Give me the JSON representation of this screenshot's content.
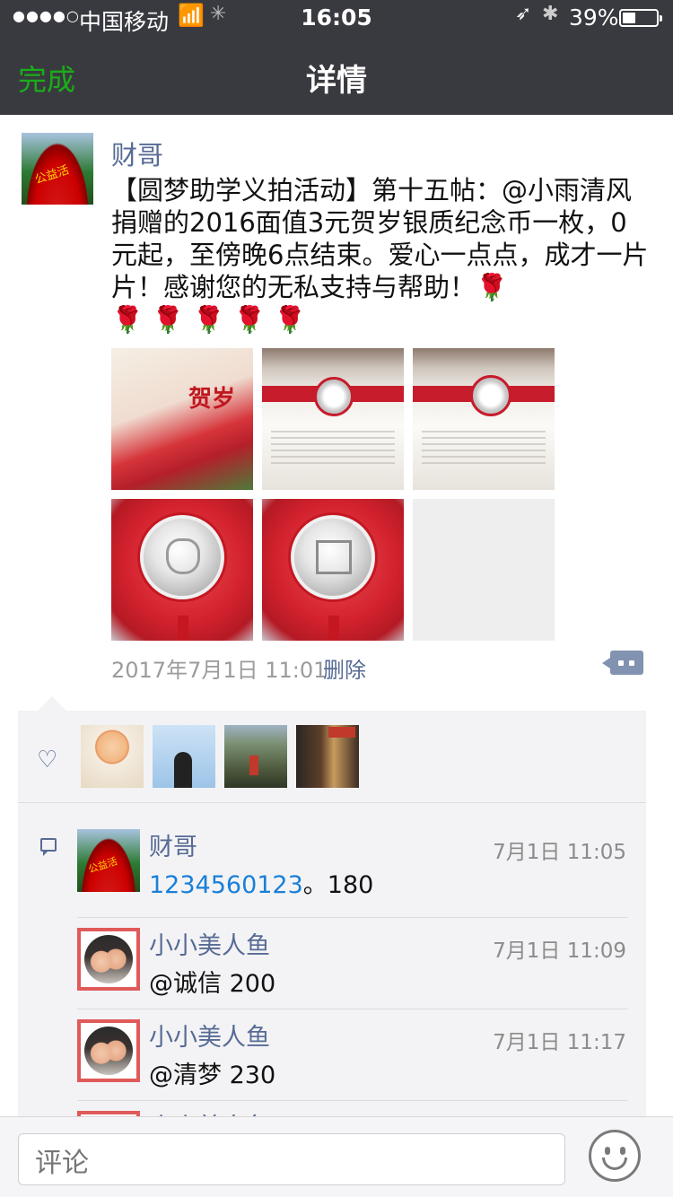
{
  "status": {
    "signal": "●●●●○",
    "carrier": "中国移动",
    "time": "16:05",
    "battery_pct": "39%",
    "battery_level": 0.39
  },
  "nav": {
    "done_label": "完成",
    "title": "详情"
  },
  "post": {
    "author": "财哥",
    "avatar_text": "公益活",
    "text": "【圆梦助学义拍活动】第十五帖：@小雨清风捐赠的2016面值3元贺岁银质纪念币一枚，0元起，至傍晚6点结束。爱心一点点，成才一片片！感谢您的无私支持与帮助！🌹\n🌹 🌹 🌹 🌹 🌹",
    "photo_caption_1": "贺岁",
    "time": "2017年7月1日 11:01",
    "delete_label": "删除"
  },
  "comments": [
    {
      "name": "财哥",
      "time": "7月1日 11:05",
      "text_link": "1234560123",
      "text_rest": "。180",
      "avatar_text": "公益活"
    },
    {
      "name": "小小美人鱼",
      "time": "7月1日 11:09",
      "text": "@诚信 200"
    },
    {
      "name": "小小美人鱼",
      "time": "7月1日 11:17",
      "text": "@清梦 230"
    },
    {
      "name": "小小美人鱼"
    }
  ],
  "input": {
    "placeholder": "评论"
  },
  "colors": {
    "accent_green": "#1aad19",
    "link_blue": "#576b95",
    "nav_bg": "#393a3f"
  }
}
